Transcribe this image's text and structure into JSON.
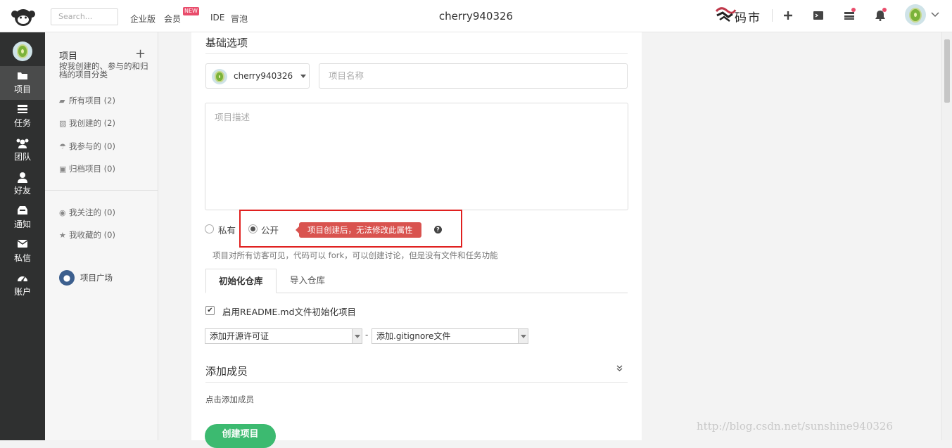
{
  "topbar": {
    "search_placeholder": "Search...",
    "nav": [
      "企业版",
      "会员",
      "IDE",
      "冒泡"
    ],
    "new_badge": "NEW",
    "username": "cherry940326",
    "brand": "码市"
  },
  "leftbar": {
    "items": [
      {
        "label": "项目",
        "icon": "folder-icon",
        "active": true
      },
      {
        "label": "任务",
        "icon": "tasks-icon",
        "active": false
      },
      {
        "label": "团队",
        "icon": "team-icon",
        "active": false
      },
      {
        "label": "好友",
        "icon": "friend-icon",
        "active": false
      },
      {
        "label": "通知",
        "icon": "notification-icon",
        "active": false
      },
      {
        "label": "私信",
        "icon": "mail-icon",
        "active": false
      },
      {
        "label": "账户",
        "icon": "account-icon",
        "active": false
      }
    ]
  },
  "sidebar": {
    "heading": "项目",
    "description": "按我创建的、参与的和归档的项目分类",
    "links": [
      {
        "label": "所有项目 (2)",
        "icon": "folder-icon"
      },
      {
        "label": "我创建的 (2)",
        "icon": "edit-icon"
      },
      {
        "label": "我参与的 (0)",
        "icon": "umbrella-icon"
      },
      {
        "label": "归档项目 (0)",
        "icon": "archive-icon"
      }
    ],
    "links2": [
      {
        "label": "我关注的 (0)",
        "icon": "eye-icon"
      },
      {
        "label": "我收藏的 (0)",
        "icon": "star-icon"
      }
    ],
    "square": "项目广场"
  },
  "form": {
    "section_title": "基础选项",
    "owner": "cherry940326",
    "name_placeholder": "项目名称",
    "desc_placeholder": "项目描述",
    "private_label": "私有",
    "public_label": "公开",
    "tooltip": "项目创建后，无法修改此属性",
    "visibility_hint": "项目对所有访客可见，代码可以 fork，可以创建讨论，但是没有文件和任务功能",
    "tabs": [
      "初始化仓库",
      "导入仓库"
    ],
    "readme_label": "启用README.md文件初始化项目",
    "license_select": "添加开源许可证",
    "gitignore_select": "添加.gitignore文件",
    "dash": "-",
    "members_title": "添加成员",
    "add_member_hint": "点击添加成员",
    "create_button": "创建项目"
  },
  "watermark": "http://blog.csdn.net/sunshine940326"
}
